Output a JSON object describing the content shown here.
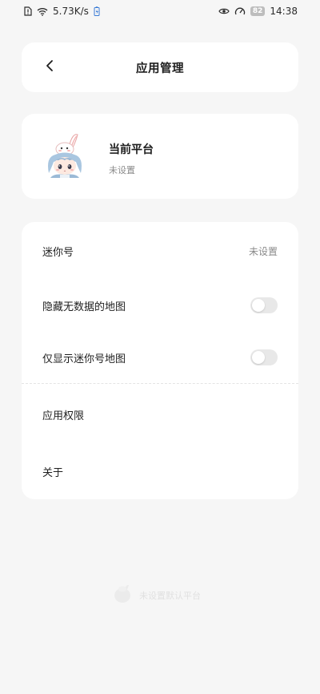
{
  "status_bar": {
    "network_speed": "5.73K/s",
    "battery_level": "82",
    "time": "14:38"
  },
  "header": {
    "title": "应用管理"
  },
  "platform": {
    "title": "当前平台",
    "status": "未设置"
  },
  "settings": {
    "mini_number": {
      "label": "迷你号",
      "value": "未设置"
    },
    "hide_empty_maps": {
      "label": "隐藏无数据的地图",
      "enabled": false
    },
    "only_mini_maps": {
      "label": "仅显示迷你号地图",
      "enabled": false
    },
    "app_permissions": {
      "label": "应用权限"
    },
    "about": {
      "label": "关于"
    }
  },
  "footer": {
    "watermark_text": "未设置默认平台"
  },
  "colors": {
    "background": "#f6f6f6",
    "card": "#ffffff",
    "toggle_off": "#e8e8e8",
    "secondary_text": "#8a8a8a"
  }
}
